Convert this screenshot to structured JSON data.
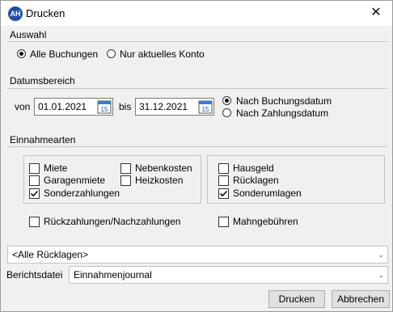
{
  "window": {
    "title": "Drucken",
    "app_icon": "AH",
    "close_glyph": "✕"
  },
  "auswahl": {
    "label": "Auswahl",
    "options": [
      {
        "label": "Alle Buchungen",
        "checked": true
      },
      {
        "label": "Nur aktuelles Konto",
        "checked": false
      }
    ]
  },
  "datumsbereich": {
    "label": "Datumsbereich",
    "from_label": "von",
    "from_value": "01.01.2021",
    "to_label": "bis",
    "to_value": "31.12.2021",
    "calendar_day": "15",
    "date_type": [
      {
        "label": "Nach Buchungsdatum",
        "checked": true
      },
      {
        "label": "Nach Zahlungsdatum",
        "checked": false
      }
    ]
  },
  "einnahmearten": {
    "label": "Einnahmearten",
    "left_group": [
      {
        "label": "Miete",
        "checked": false
      },
      {
        "label": "Nebenkosten",
        "checked": false
      },
      {
        "label": "Garagenmiete",
        "checked": false
      },
      {
        "label": "Heizkosten",
        "checked": false
      },
      {
        "label": "Sonderzahlungen",
        "checked": true
      }
    ],
    "right_group": [
      {
        "label": "Hausgeld",
        "checked": false
      },
      {
        "label": "Rücklagen",
        "checked": false
      },
      {
        "label": "Sonderumlagen",
        "checked": true
      }
    ],
    "rueckzahlungen": {
      "label": "Rückzahlungen/Nachzahlungen",
      "checked": false
    },
    "mahngebuehren": {
      "label": "Mahngebühren",
      "checked": false
    }
  },
  "ruecklagen_select": {
    "value": "<Alle Rücklagen>"
  },
  "berichtsdatei": {
    "label": "Berichtsdatei",
    "value": "Einnahmenjournal"
  },
  "buttons": {
    "print": "Drucken",
    "cancel": "Abbrechen"
  },
  "colors": {
    "icon_blue": "#1f4fa3",
    "background": "#f0f0f0",
    "calendar_blue": "#3a7bd5"
  }
}
